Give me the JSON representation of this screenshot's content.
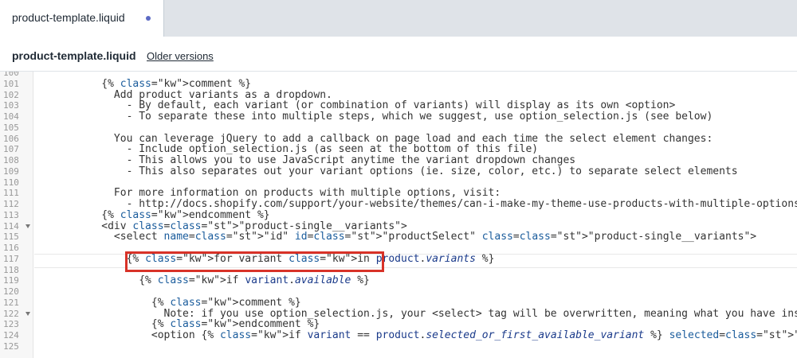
{
  "tab": {
    "label": "product-template.liquid"
  },
  "file_bar": {
    "title": "product-template.liquid",
    "older_versions": "Older versions"
  },
  "editor": {
    "lines": [
      {
        "num": "100",
        "text": ""
      },
      {
        "num": "101",
        "text": "          {% comment %}"
      },
      {
        "num": "102",
        "text": "            Add product variants as a dropdown."
      },
      {
        "num": "103",
        "text": "              - By default, each variant (or combination of variants) will display as its own <option>"
      },
      {
        "num": "104",
        "text": "              - To separate these into multiple steps, which we suggest, use option_selection.js (see below)"
      },
      {
        "num": "105",
        "text": ""
      },
      {
        "num": "106",
        "text": "            You can leverage jQuery to add a callback on page load and each time the select element changes:"
      },
      {
        "num": "107",
        "text": "              - Include option_selection.js (as seen at the bottom of this file)"
      },
      {
        "num": "108",
        "text": "              - This allows you to use JavaScript anytime the variant dropdown changes"
      },
      {
        "num": "109",
        "text": "              - This also separates out your variant options (ie. size, color, etc.) to separate select elements"
      },
      {
        "num": "110",
        "text": ""
      },
      {
        "num": "111",
        "text": "            For more information on products with multiple options, visit:"
      },
      {
        "num": "112",
        "text": "              - http://docs.shopify.com/support/your-website/themes/can-i-make-my-theme-use-products-with-multiple-options"
      },
      {
        "num": "113",
        "text": "          {% endcomment %}"
      },
      {
        "num": "114",
        "text": "          <div class=\"product-single__variants\">"
      },
      {
        "num": "115",
        "text": "            <select name=\"id\" id=\"productSelect\" class=\"product-single__variants\">"
      },
      {
        "num": "116",
        "text": ""
      },
      {
        "num": "117",
        "text": "              {% for variant in product.variants %}"
      },
      {
        "num": "118",
        "text": ""
      },
      {
        "num": "119",
        "text": "                {% if variant.available %}"
      },
      {
        "num": "120",
        "text": ""
      },
      {
        "num": "121",
        "text": "                  {% comment %}"
      },
      {
        "num": "122",
        "text": "                    Note: if you use option_selection.js, your <select> tag will be overwritten, meaning what you have inside <option> will not reflect what you coded below."
      },
      {
        "num": "123",
        "text": "                  {% endcomment %}"
      },
      {
        "num": "124",
        "text": "                  <option {% if variant == product.selected_or_first_available_variant %} selected=\"selected\" {% endif %} data-sku=\"{{ variant.sku }}\" value=\"{{ variant.id }}\">{{ variant.title }}</option>"
      },
      {
        "num": "125",
        "text": ""
      }
    ]
  }
}
